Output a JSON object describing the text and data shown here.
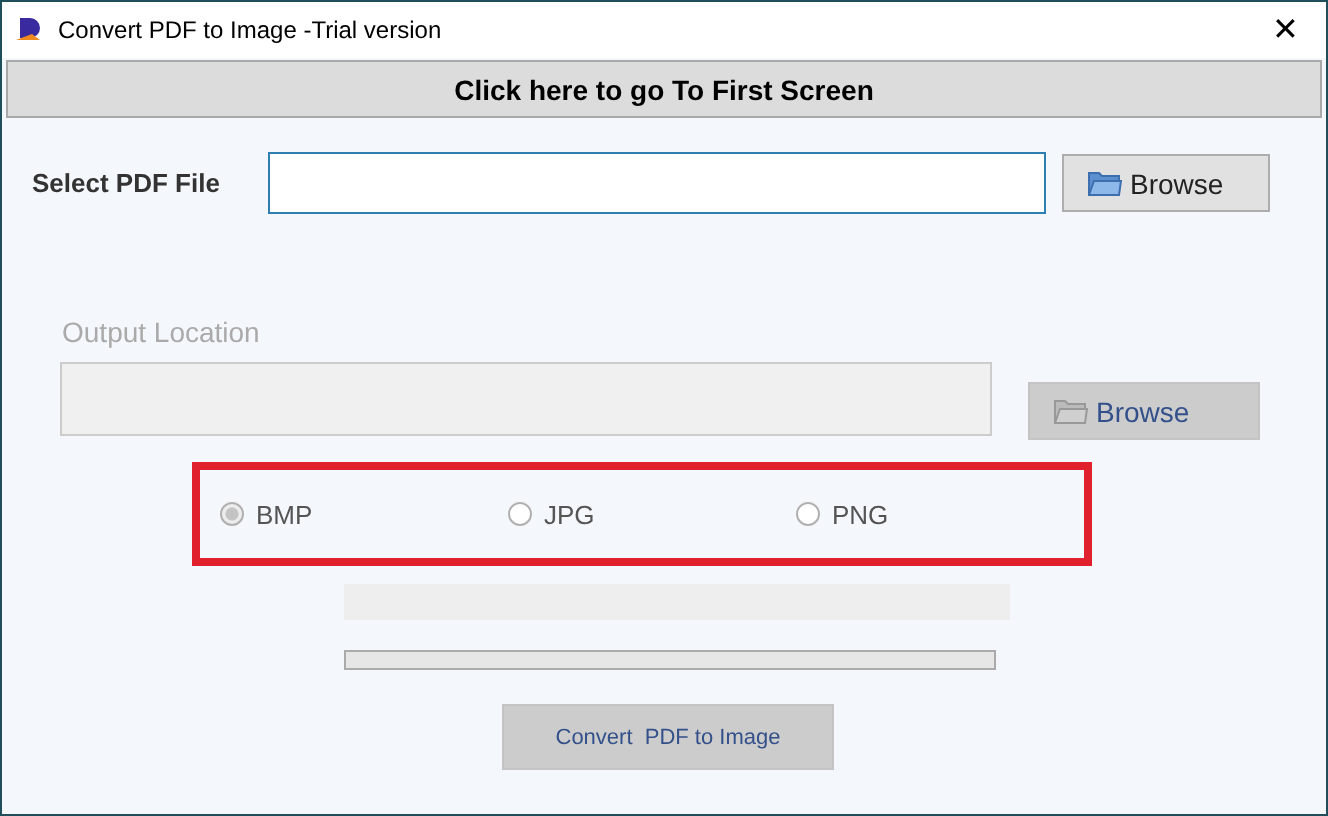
{
  "window": {
    "title": "Convert PDF to Image -Trial version",
    "close": "✕"
  },
  "first_screen_button": "Click here to go To First Screen",
  "select_pdf": {
    "label": "Select PDF File",
    "browse": "Browse"
  },
  "output": {
    "label": "Output Location",
    "browse": "Browse"
  },
  "formats": [
    {
      "label": "BMP",
      "selected": true
    },
    {
      "label": "JPG",
      "selected": false
    },
    {
      "label": "PNG",
      "selected": false
    }
  ],
  "convert_button": "Convert  PDF to Image"
}
